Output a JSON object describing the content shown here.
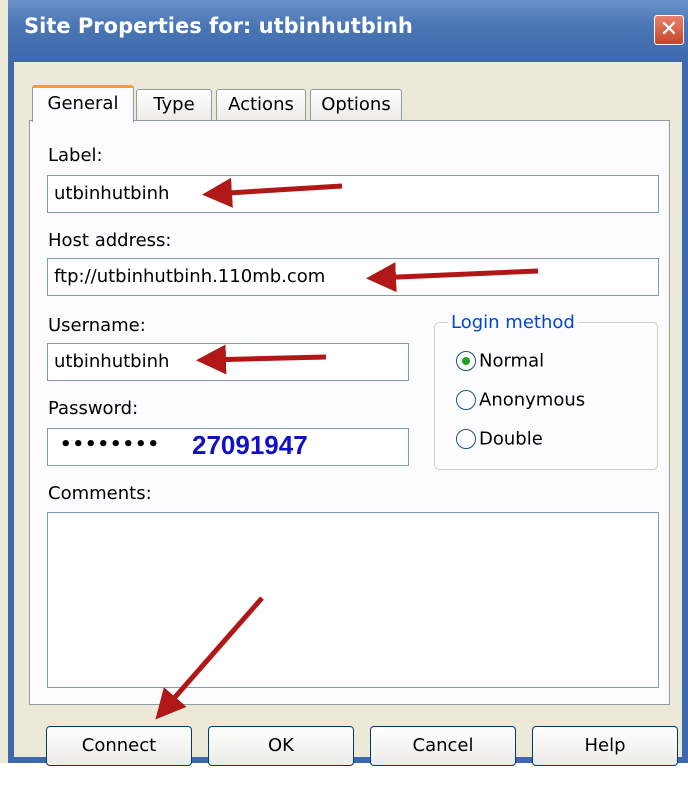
{
  "window": {
    "title": "Site Properties for: utbinhutbinh",
    "close_glyph": "✕"
  },
  "tabs": [
    {
      "label": "General",
      "active": true
    },
    {
      "label": "Type",
      "active": false
    },
    {
      "label": "Actions",
      "active": false
    },
    {
      "label": "Options",
      "active": false
    }
  ],
  "form": {
    "label_caption": "Label:",
    "label_value": "utbinhutbinh",
    "host_caption": "Host address:",
    "host_value": "ftp://utbinhutbinh.110mb.com",
    "username_caption": "Username:",
    "username_value": "utbinhutbinh",
    "password_caption": "Password:",
    "password_masked": "••••••••",
    "password_revealed": "27091947",
    "comments_caption": "Comments:",
    "comments_value": ""
  },
  "login_method": {
    "title": "Login method",
    "options": [
      {
        "label": "Normal",
        "selected": true
      },
      {
        "label": "Anonymous",
        "selected": false
      },
      {
        "label": "Double",
        "selected": false
      }
    ]
  },
  "buttons": {
    "connect": "Connect",
    "ok": "OK",
    "cancel": "Cancel",
    "help": "Help"
  },
  "annotations": {
    "arrow_color": "#b01818",
    "reveal_color": "#1010c8"
  }
}
